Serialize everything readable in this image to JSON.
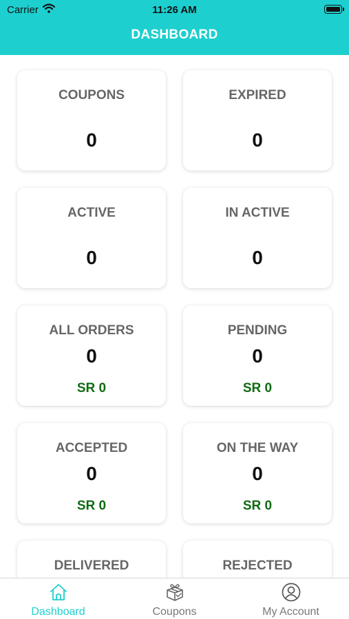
{
  "status_bar": {
    "carrier": "Carrier",
    "time": "11:26 AM"
  },
  "header": {
    "title": "DASHBOARD",
    "color": "#1ecfcf"
  },
  "cards": [
    {
      "label": "COUPONS",
      "count": "0"
    },
    {
      "label": "EXPIRED",
      "count": "0"
    },
    {
      "label": "ACTIVE",
      "count": "0"
    },
    {
      "label": "IN ACTIVE",
      "count": "0"
    },
    {
      "label": "ALL ORDERS",
      "count": "0",
      "amount": "SR 0"
    },
    {
      "label": "PENDING",
      "count": "0",
      "amount": "SR 0"
    },
    {
      "label": "ACCEPTED",
      "count": "0",
      "amount": "SR 0"
    },
    {
      "label": "ON THE WAY",
      "count": "0",
      "amount": "SR 0"
    },
    {
      "label": "DELIVERED"
    },
    {
      "label": "REJECTED"
    }
  ],
  "amount_color": "#0f6b12",
  "tabbar": {
    "items": [
      {
        "label": "Dashboard",
        "icon": "home-icon",
        "active": true
      },
      {
        "label": "Coupons",
        "icon": "gift-box-icon",
        "active": false
      },
      {
        "label": "My Account",
        "icon": "user-circle-icon",
        "active": false
      }
    ]
  }
}
